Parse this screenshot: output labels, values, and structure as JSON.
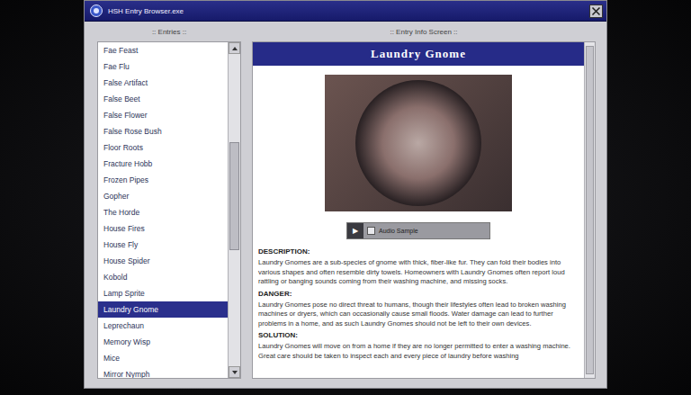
{
  "window": {
    "title": "HSH Entry Browser.exe"
  },
  "entries_panel": {
    "header": ":: Entries ::"
  },
  "entries": [
    {
      "label": "Fae Feast",
      "selected": false
    },
    {
      "label": "Fae Flu",
      "selected": false
    },
    {
      "label": "False Artifact",
      "selected": false
    },
    {
      "label": "False Beet",
      "selected": false
    },
    {
      "label": "False Flower",
      "selected": false
    },
    {
      "label": "False Rose Bush",
      "selected": false
    },
    {
      "label": "Floor Roots",
      "selected": false
    },
    {
      "label": "Fracture Hobb",
      "selected": false
    },
    {
      "label": "Frozen Pipes",
      "selected": false
    },
    {
      "label": "Gopher",
      "selected": false
    },
    {
      "label": "The Horde",
      "selected": false
    },
    {
      "label": "House Fires",
      "selected": false
    },
    {
      "label": "House Fly",
      "selected": false
    },
    {
      "label": "House Spider",
      "selected": false
    },
    {
      "label": "Kobold",
      "selected": false
    },
    {
      "label": "Lamp Sprite",
      "selected": false
    },
    {
      "label": "Laundry Gnome",
      "selected": true
    },
    {
      "label": "Leprechaun",
      "selected": false
    },
    {
      "label": "Memory Wisp",
      "selected": false
    },
    {
      "label": "Mice",
      "selected": false
    },
    {
      "label": "Mirror Nymph",
      "selected": false
    }
  ],
  "info_panel": {
    "header": ":: Entry Info Screen ::",
    "title": "Laundry Gnome",
    "audio": {
      "play": "▶",
      "label": "Audio Sample"
    },
    "sections": [
      {
        "heading": "DESCRIPTION:",
        "text": "Laundry Gnomes are a sub-species of gnome with thick, fiber-like fur. They can fold their bodies into various shapes and often resemble dirty towels. Homeowners with Laundry Gnomes often report loud rattling or banging sounds coming from their washing machine, and missing socks."
      },
      {
        "heading": "DANGER:",
        "text": "Laundry Gnomes pose no direct threat to humans, though their lifestyles often lead to broken washing machines or dryers, which can occasionally cause small floods. Water damage can lead to further problems in a home, and as such Laundry Gnomes should not be left to their own devices."
      },
      {
        "heading": "SOLUTION:",
        "text": "Laundry Gnomes will move on from a home if they are no longer permitted to enter a washing machine. Great care should be taken to inspect each and every piece of laundry before washing"
      }
    ]
  }
}
